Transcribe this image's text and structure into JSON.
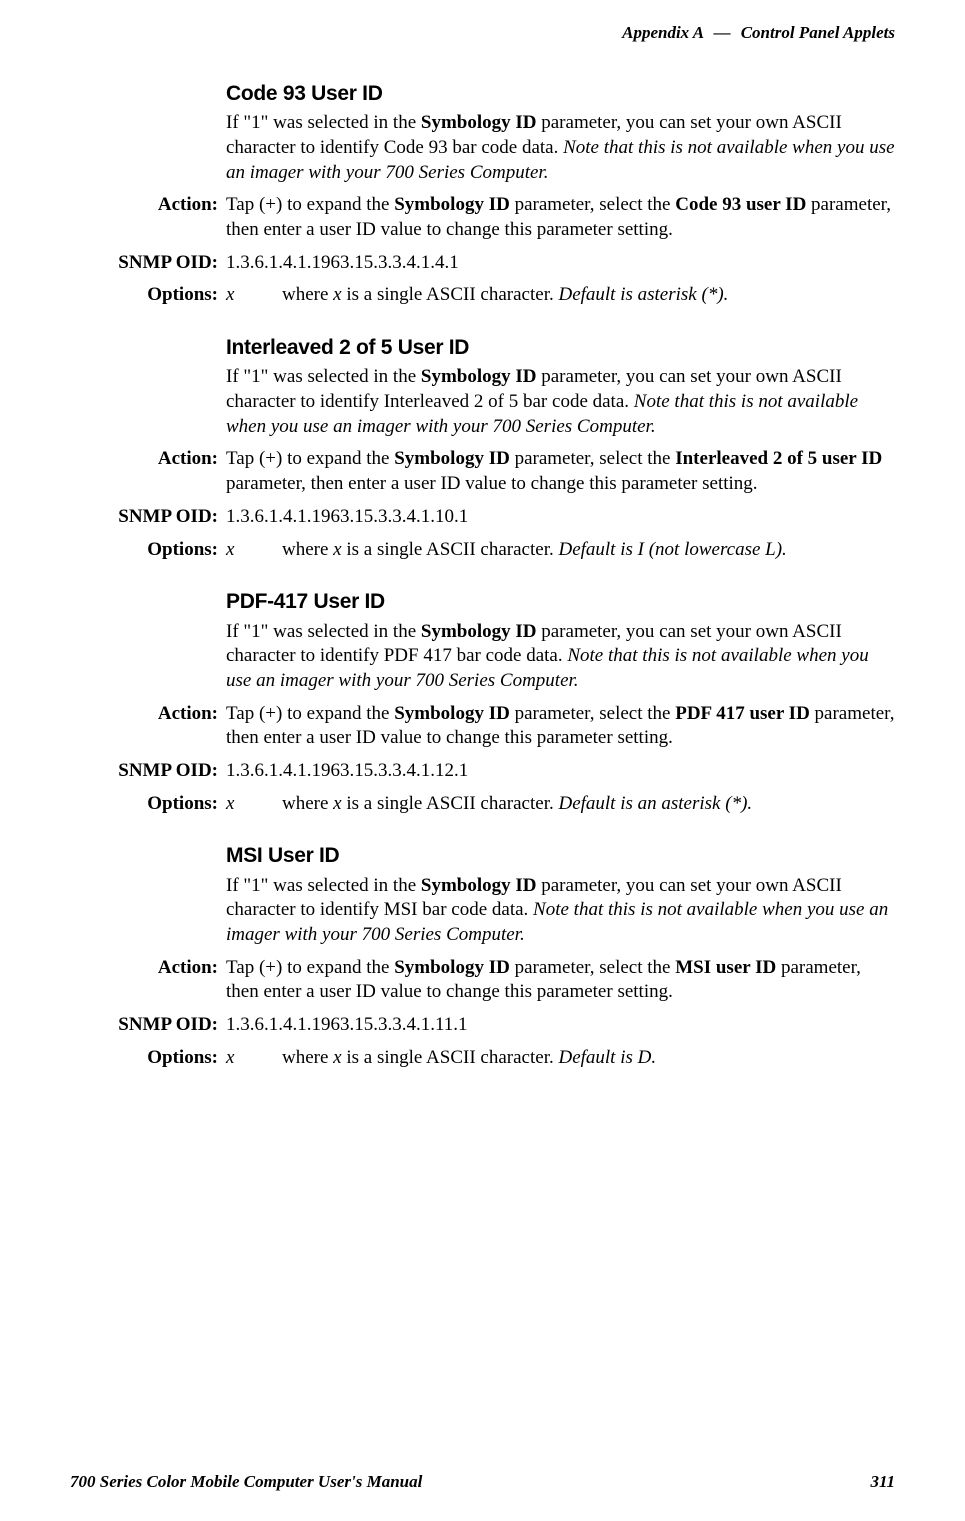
{
  "header": {
    "left": "Appendix A",
    "sep": "—",
    "right": "Control Panel Applets"
  },
  "sections": [
    {
      "title": "Code 93 User ID",
      "intro_pre": "If \"1\" was selected in the ",
      "intro_bold1": "Symbology ID",
      "intro_mid": " parameter, you can set your own ASCII character to identify Code 93 bar code data. ",
      "intro_ital": "Note that this is not available when you use an imager with your 700 Series Computer.",
      "action_pre": "Tap (+) to expand the ",
      "action_bold1": "Symbology ID",
      "action_mid": " parameter, select the ",
      "action_bold2": "Code 93 user ID",
      "action_post": " parameter, then enter a user ID value to change this parameter setting.",
      "oid": "1.3.6.1.4.1.1963.15.3.3.4.1.4.1",
      "opt_x": "x",
      "opt_pre": "where ",
      "opt_ital_x": "x",
      "opt_mid": " is a single ASCII character. ",
      "opt_default": "Default is asterisk (*)."
    },
    {
      "title": "Interleaved 2 of 5 User ID",
      "intro_pre": "If \"1\" was selected in the ",
      "intro_bold1": "Symbology ID",
      "intro_mid": " parameter, you can set your own ASCII character to identify Interleaved 2 of 5 bar code data. ",
      "intro_ital": "Note that this is not available when you use an imager with your 700 Series Computer.",
      "action_pre": "Tap (+) to expand the ",
      "action_bold1": "Symbology ID",
      "action_mid": " parameter, select the ",
      "action_bold2": "Interleaved 2 of 5 user ID",
      "action_post": " parameter, then enter a user ID value to change this parameter setting.",
      "oid": "1.3.6.1.4.1.1963.15.3.3.4.1.10.1",
      "opt_x": "x",
      "opt_pre": "where ",
      "opt_ital_x": "x",
      "opt_mid": " is a single ASCII character. ",
      "opt_default": "Default is I (not lowercase L)."
    },
    {
      "title": "PDF-417 User ID",
      "intro_pre": "If \"1\" was selected in the ",
      "intro_bold1": "Symbology ID",
      "intro_mid": " parameter, you can set your own ASCII character to identify PDF 417 bar code data. ",
      "intro_ital": "Note that this is not available when you use an imager with your 700 Series Computer.",
      "action_pre": "Tap (+) to expand the ",
      "action_bold1": "Symbology ID",
      "action_mid": " parameter, select the ",
      "action_bold2": "PDF 417 user ID",
      "action_post": " parameter, then enter a user ID value to change this parameter setting.",
      "oid": "1.3.6.1.4.1.1963.15.3.3.4.1.12.1",
      "opt_x": "x",
      "opt_pre": "where ",
      "opt_ital_x": "x",
      "opt_mid": " is a single ASCII character. ",
      "opt_default": "Default is an asterisk (*)."
    },
    {
      "title": "MSI User ID",
      "intro_pre": "If \"1\" was selected in the ",
      "intro_bold1": "Symbology ID",
      "intro_mid": " parameter, you can set your own ASCII character to identify MSI bar code data. ",
      "intro_ital": "Note that this is not available when you use an imager with your 700 Series Computer.",
      "action_pre": "Tap (+) to expand the ",
      "action_bold1": "Symbology ID",
      "action_mid": " parameter, select the ",
      "action_bold2": "MSI user ID",
      "action_post": " parameter, then enter a user ID value to change this parameter setting.",
      "oid": "1.3.6.1.4.1.1963.15.3.3.4.1.11.1",
      "opt_x": "x",
      "opt_pre": "where ",
      "opt_ital_x": "x",
      "opt_mid": " is a single ASCII character. ",
      "opt_default": "Default is D."
    }
  ],
  "labels": {
    "action": "Action:",
    "oid": "SNMP OID:",
    "options": "Options:"
  },
  "footer": {
    "left": "700 Series Color Mobile Computer User's Manual",
    "right": "311"
  }
}
